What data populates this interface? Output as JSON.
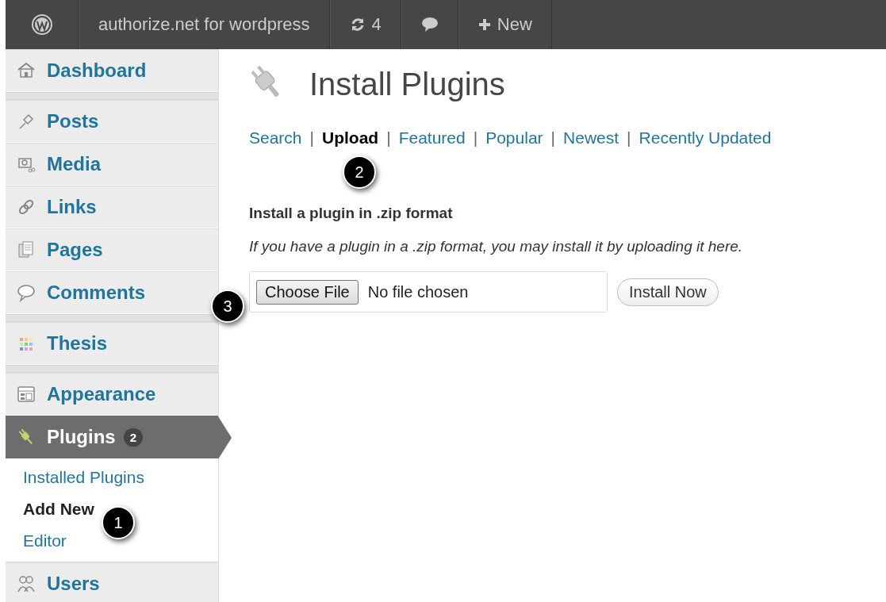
{
  "admin_bar": {
    "site_name": "authorize.net for wordpress",
    "updates_count": "4",
    "new_label": "New"
  },
  "sidebar": {
    "groups": [
      [
        {
          "label": "Dashboard",
          "selected": false
        }
      ],
      [
        {
          "label": "Posts",
          "selected": false
        },
        {
          "label": "Media",
          "selected": false
        },
        {
          "label": "Links",
          "selected": false
        },
        {
          "label": "Pages",
          "selected": false
        },
        {
          "label": "Comments",
          "selected": false
        }
      ],
      [
        {
          "label": "Thesis",
          "selected": false
        }
      ],
      [
        {
          "label": "Appearance",
          "selected": false
        },
        {
          "label": "Plugins",
          "selected": true,
          "badge": "2",
          "children": [
            {
              "label": "Installed Plugins",
              "selected": false
            },
            {
              "label": "Add New",
              "selected": true
            },
            {
              "label": "Editor",
              "selected": false
            }
          ]
        },
        {
          "label": "Users",
          "selected": false
        }
      ]
    ]
  },
  "page": {
    "title": "Install Plugins",
    "tabs": [
      {
        "label": "Search",
        "selected": false
      },
      {
        "label": "Upload",
        "selected": true
      },
      {
        "label": "Featured",
        "selected": false
      },
      {
        "label": "Popular",
        "selected": false
      },
      {
        "label": "Newest",
        "selected": false
      },
      {
        "label": "Recently Updated",
        "selected": false
      }
    ],
    "tab_separators": [
      "|",
      "|",
      "|",
      "|",
      "|"
    ],
    "section_title": "Install a plugin in .zip format",
    "description": "If you have a plugin in a .zip format, you may install it by uploading it here.",
    "file_button": "Choose File",
    "file_status": "No file chosen",
    "install_button": "Install Now"
  },
  "callouts": [
    {
      "number": "1"
    },
    {
      "number": "2"
    },
    {
      "number": "3"
    }
  ]
}
